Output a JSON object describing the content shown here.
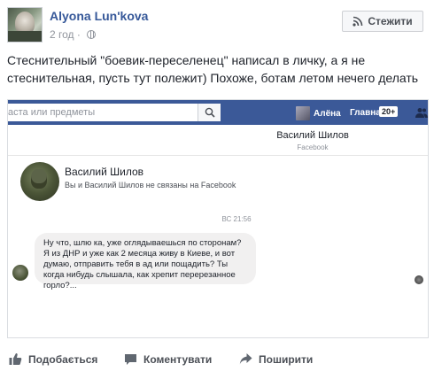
{
  "post": {
    "author": "Alyona Lun'kova",
    "time": "2 год",
    "separator": "·",
    "follow_label": "Стежити",
    "text": "Стеснительный \"боевик-переселенец\" написал в личку, а я не стеснительная, пусть тут полежит) Похоже, ботам летом нечего делать"
  },
  "screenshot": {
    "topbar": {
      "search_placeholder": "аста или предметы",
      "user_name": "Алёна",
      "home_label": "Главная",
      "home_count": "20+"
    },
    "chat_header": {
      "name": "Василий Шилов",
      "subtitle": "Facebook"
    },
    "profile": {
      "name": "Василий Шилов",
      "subtitle": "Вы и Василий Шилов не связаны на Facebook"
    },
    "timestamp": "ВС 21:56",
    "message": "Ну что, шлю  ка, уже оглядываешься по сторонам? Я из ДНР и уже как 2 месяца живу в Киеве, и вот думаю, отправить тебя в ад или пощадить? Ты когда нибудь слышала, как хрепит перерезанное горло?..."
  },
  "actions": {
    "like": "Подобається",
    "comment": "Коментувати",
    "share": "Поширити"
  },
  "colors": {
    "link_blue": "#365899",
    "fb_bar": "#3b5998",
    "action_grey": "#4b4f56",
    "bubble_bg": "#f1f0f0"
  },
  "icons": [
    "rss-icon",
    "globe-icon",
    "search-icon",
    "friends-icon",
    "like-icon",
    "comment-icon",
    "share-icon"
  ]
}
